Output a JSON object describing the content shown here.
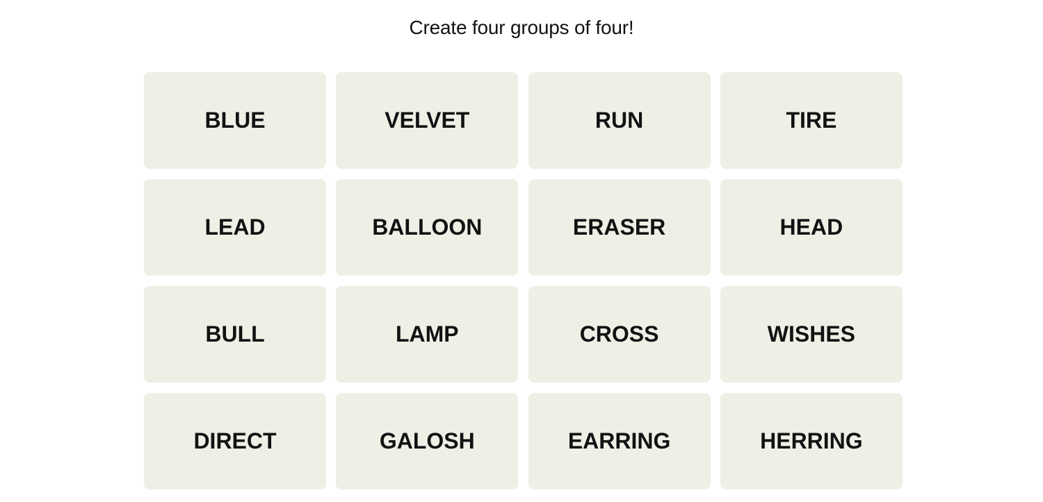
{
  "header": {
    "prompt": "Create four groups of four!"
  },
  "board": {
    "tile_color": "#efefe6",
    "tiles": [
      {
        "word": "BLUE"
      },
      {
        "word": "VELVET"
      },
      {
        "word": "RUN"
      },
      {
        "word": "TIRE"
      },
      {
        "word": "LEAD"
      },
      {
        "word": "BALLOON"
      },
      {
        "word": "ERASER"
      },
      {
        "word": "HEAD"
      },
      {
        "word": "BULL"
      },
      {
        "word": "LAMP"
      },
      {
        "word": "CROSS"
      },
      {
        "word": "WISHES"
      },
      {
        "word": "DIRECT"
      },
      {
        "word": "GALOSH"
      },
      {
        "word": "EARRING"
      },
      {
        "word": "HERRING"
      }
    ]
  }
}
